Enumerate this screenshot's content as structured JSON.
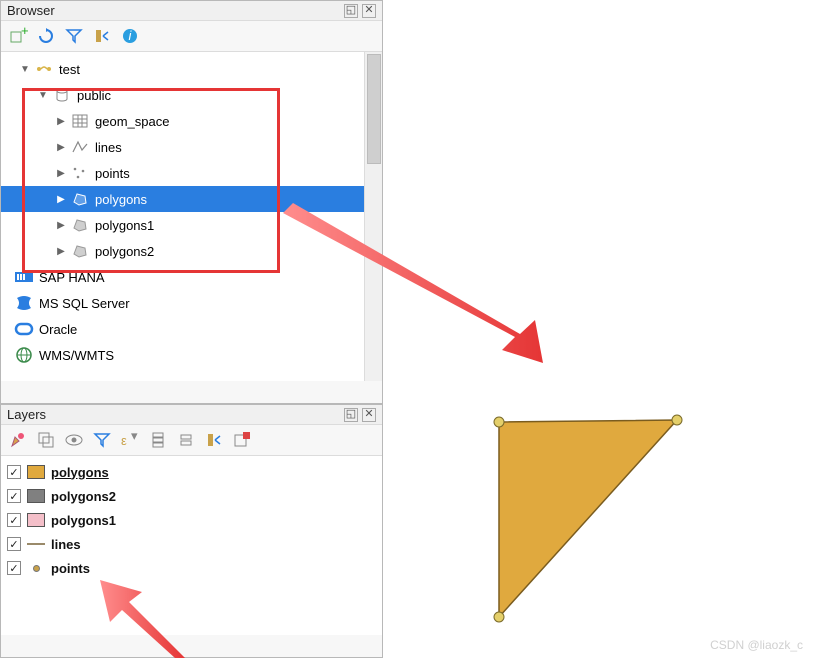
{
  "browser": {
    "title": "Browser",
    "tree": {
      "test": "test",
      "public": "public",
      "geom_space": "geom_space",
      "lines": "lines",
      "points": "points",
      "polygons": "polygons",
      "polygons1": "polygons1",
      "polygons2": "polygons2",
      "sap_hana": "SAP HANA",
      "mssql": "MS SQL Server",
      "oracle": "Oracle",
      "wms": "WMS/WMTS"
    }
  },
  "layers": {
    "title": "Layers",
    "items": [
      {
        "name": "polygons",
        "color": "#e0a93e",
        "underline": true
      },
      {
        "name": "polygons2",
        "color": "#808080",
        "underline": false
      },
      {
        "name": "polygons1",
        "color": "#f4bfc9",
        "underline": false
      },
      {
        "name": "lines",
        "color": "line",
        "underline": false
      },
      {
        "name": "points",
        "color": "point",
        "underline": false
      }
    ]
  },
  "watermark": "CSDN @liaozk_c",
  "colors": {
    "selection": "#2a7ee0",
    "polygon_fill": "#e0a93e",
    "polygon_stroke": "#7a5c1f",
    "vertex": "#c9b03c",
    "annotation_red": "#e53535"
  }
}
